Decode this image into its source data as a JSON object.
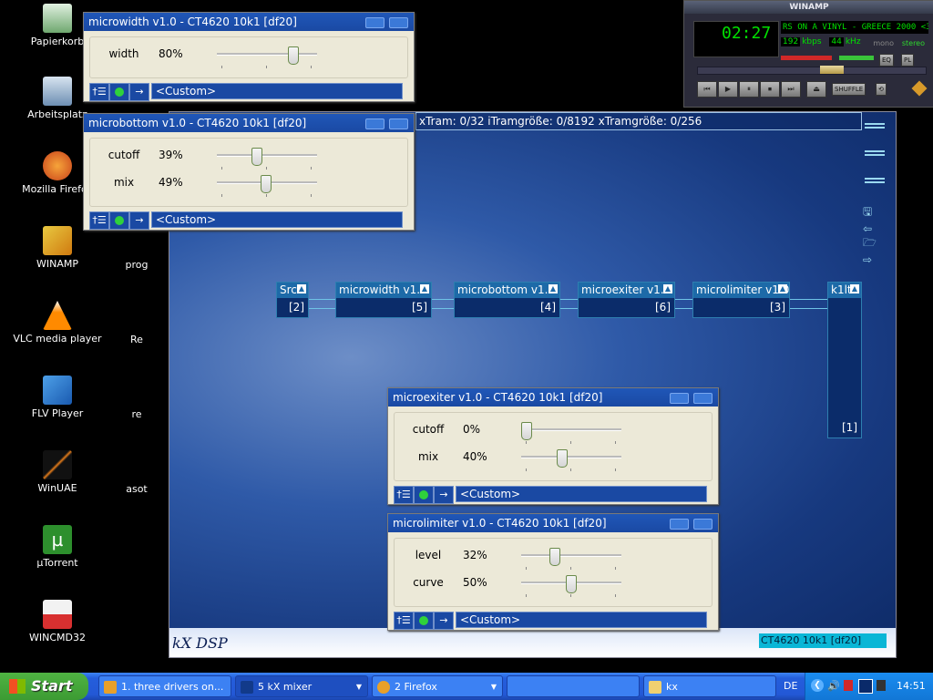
{
  "desktop": {
    "icons": [
      {
        "label": "Papierkorb",
        "icon": "recycle-bin-icon"
      },
      {
        "label": "Arbeitsplatz",
        "icon": "my-computer-icon"
      },
      {
        "label": "Mozilla Firefox",
        "icon": "firefox-icon"
      },
      {
        "label": "WINAMP",
        "icon": "winamp-icon"
      },
      {
        "label": "VLC media player",
        "icon": "vlc-icon"
      },
      {
        "label": "FLV Player",
        "icon": "flv-player-icon"
      },
      {
        "label": "WinUAE",
        "icon": "winuae-icon"
      },
      {
        "label": "µTorrent",
        "icon": "utorrent-icon"
      },
      {
        "label": "WINCMD32",
        "icon": "wincmd-icon"
      }
    ],
    "partial_icons": [
      "prog",
      "Re",
      "re",
      "asot"
    ]
  },
  "dsp": {
    "info": "xTram: 0/32 iTramgröße: 0/8192 xTramgröße: 0/256",
    "logo": "kX DSP",
    "device": "CT4620 10k1 [df20]",
    "plugins": [
      {
        "name": "Src",
        "id": "[2]"
      },
      {
        "name": "microwidth v1.0",
        "id": "[5]"
      },
      {
        "name": "microbottom v1.0",
        "id": "[4]"
      },
      {
        "name": "microexiter v1.0",
        "id": "[6]"
      },
      {
        "name": "microlimiter v1.0",
        "id": "[3]"
      },
      {
        "name": "k1lt",
        "id": "[1]"
      }
    ]
  },
  "dialogs": {
    "microwidth": {
      "title": "microwidth v1.0 - CT4620 10k1 [df20]",
      "params": [
        {
          "label": "width",
          "value": "80%",
          "level": 0.8
        }
      ],
      "preset": "<Custom>"
    },
    "microbottom": {
      "title": "microbottom v1.0 - CT4620 10k1 [df20]",
      "params": [
        {
          "label": "cutoff",
          "value": "39%",
          "level": 0.39
        },
        {
          "label": "mix",
          "value": "49%",
          "level": 0.49
        }
      ],
      "preset": "<Custom>"
    },
    "microexiter": {
      "title": "microexiter v1.0 - CT4620 10k1 [df20]",
      "params": [
        {
          "label": "cutoff",
          "value": "0%",
          "level": 0.0
        },
        {
          "label": "mix",
          "value": "40%",
          "level": 0.4
        }
      ],
      "preset": "<Custom>"
    },
    "microlimiter": {
      "title": "microlimiter v1.0 - CT4620 10k1 [df20]",
      "params": [
        {
          "label": "level",
          "value": "32%",
          "level": 0.32
        },
        {
          "label": "curve",
          "value": "50%",
          "level": 0.5
        }
      ],
      "preset": "<Custom>"
    }
  },
  "winamp": {
    "title": "WINAMP",
    "time": "02:27",
    "song": "RS ON A VINYL - GREECE 2000 <3:",
    "kbps": "192",
    "kbps_label": "kbps",
    "khz": "44",
    "khz_label": "kHz",
    "mono": "mono",
    "stereo": "stereo",
    "eq": "EQ",
    "pl": "PL",
    "shuffle": "SHUFFLE",
    "seek_progress": 0.6
  },
  "taskbar": {
    "start": "Start",
    "tasks": [
      {
        "label": "1. three drivers on..."
      },
      {
        "label": "5 kX mixer"
      },
      {
        "label": "2 Firefox"
      },
      {
        "label": ""
      },
      {
        "label": "kx"
      }
    ],
    "lang": "DE",
    "clock": "14:51"
  },
  "colors": {
    "dsp_bg": "#1e4596",
    "title_bar": "#1a49a3",
    "device_label": "#0ab6d6"
  }
}
